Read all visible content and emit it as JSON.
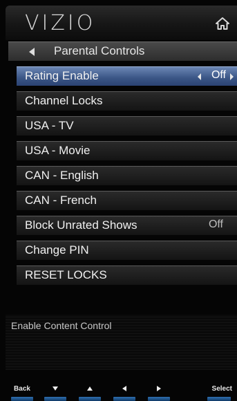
{
  "header": {
    "logo_text": "VIZIO",
    "home_icon": "home-icon"
  },
  "breadcrumb": {
    "back_icon": "back-arrow-icon",
    "title": "Parental Controls"
  },
  "menu": {
    "items": [
      {
        "label": "Rating Enable",
        "value": "Off",
        "selected": true
      },
      {
        "label": "Channel Locks",
        "value": ""
      },
      {
        "label": "USA - TV",
        "value": ""
      },
      {
        "label": "USA - Movie",
        "value": ""
      },
      {
        "label": "CAN - English",
        "value": ""
      },
      {
        "label": "CAN - French",
        "value": ""
      },
      {
        "label": "Block Unrated Shows",
        "value": "Off"
      },
      {
        "label": "Change PIN",
        "value": ""
      },
      {
        "label": "RESET LOCKS",
        "value": ""
      }
    ]
  },
  "description": "Enable Content Control",
  "footer": {
    "back": "Back",
    "down_icon": "down-arrow-icon",
    "up_icon": "up-arrow-icon",
    "left_icon": "left-arrow-icon",
    "right_icon": "right-arrow-icon",
    "select": "Select"
  },
  "colors": {
    "selected": "#3a5585",
    "accent_bar": "#2f6fb0"
  }
}
